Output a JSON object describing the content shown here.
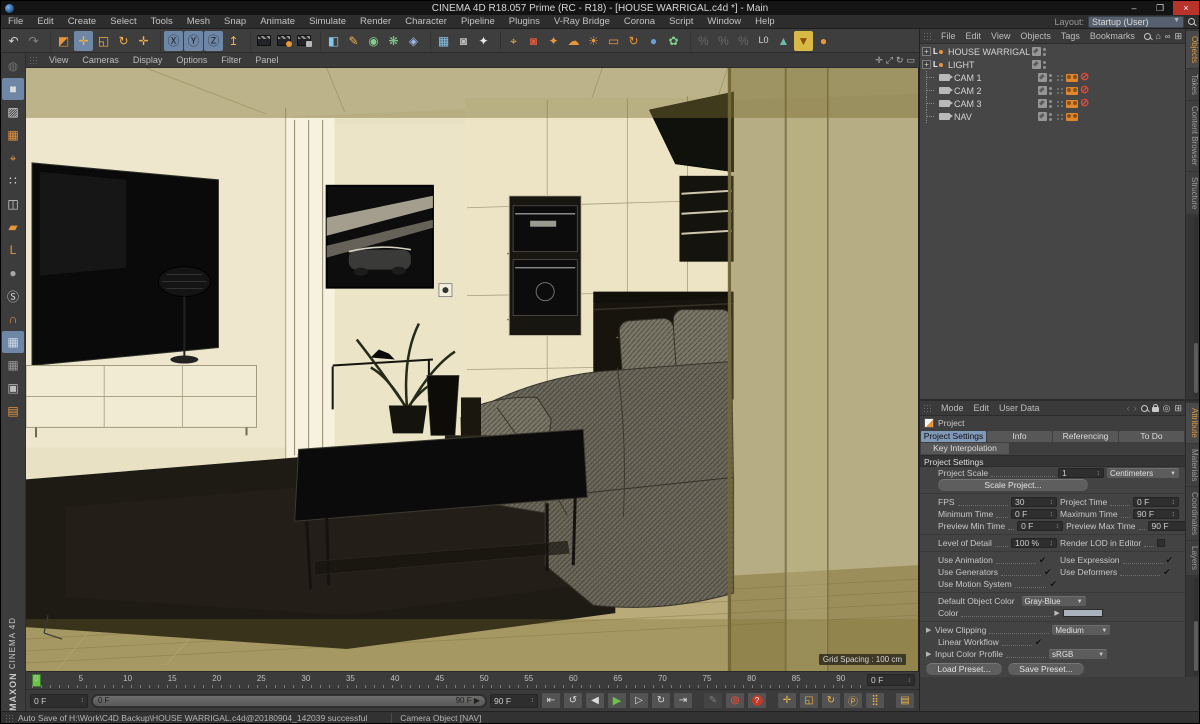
{
  "window": {
    "title": "CINEMA 4D R18.057 Prime (RC - R18) - [HOUSE WARRIGAL.c4d *] - Main",
    "minimize": "–",
    "maximize": "❐",
    "close": "×",
    "layout_label": "Layout:",
    "layout_value": "Startup (User)"
  },
  "menubar": [
    "File",
    "Edit",
    "Create",
    "Select",
    "Tools",
    "Mesh",
    "Snap",
    "Animate",
    "Simulate",
    "Render",
    "Character",
    "Pipeline",
    "Plugins",
    "V-Ray Bridge",
    "Corona",
    "Script",
    "Window",
    "Help"
  ],
  "toolbar": {
    "icons": [
      {
        "name": "undo-icon",
        "glyph": "↶",
        "color": "#d6d6d6"
      },
      {
        "name": "redo-icon",
        "glyph": "↷",
        "color": "#d6d6d6",
        "dim": true
      },
      {
        "sep": true
      },
      {
        "name": "live-selection-icon",
        "glyph": "◩",
        "color": "#e8953c"
      },
      {
        "name": "move-icon",
        "glyph": "✛",
        "color": "#f0b24a",
        "active": true
      },
      {
        "name": "scale-icon",
        "glyph": "◱",
        "color": "#f0b24a"
      },
      {
        "name": "rotate-icon",
        "glyph": "↻",
        "color": "#f0b24a"
      },
      {
        "name": "last-tool-icon",
        "glyph": "✛",
        "color": "#f0b24a"
      },
      {
        "sep": true
      },
      {
        "name": "lock-x-icon",
        "glyph": "Ⓧ",
        "color": "#1e2834",
        "active": true
      },
      {
        "name": "lock-y-icon",
        "glyph": "Ⓨ",
        "color": "#1e2834",
        "active": true
      },
      {
        "name": "lock-z-icon",
        "glyph": "Ⓩ",
        "color": "#1e2834",
        "active": true
      },
      {
        "name": "coordinate-system-icon",
        "glyph": "↥",
        "color": "#f0b24a"
      },
      {
        "sep": true
      },
      {
        "name": "render-view-icon",
        "clapper": "plain"
      },
      {
        "name": "render-to-picture-viewer-icon",
        "clapper": "oj"
      },
      {
        "name": "render-settings-icon",
        "clapper": "gr"
      },
      {
        "sep": true
      },
      {
        "name": "add-cube-icon",
        "glyph": "◧",
        "color": "#86c5ea"
      },
      {
        "name": "spline-pen-icon",
        "glyph": "✎",
        "color": "#f0b24a"
      },
      {
        "name": "subdivision-surface-icon",
        "glyph": "◉",
        "color": "#7fcf8a"
      },
      {
        "name": "array-icon",
        "glyph": "❋",
        "color": "#7fcf8a"
      },
      {
        "name": "deformer-icon",
        "glyph": "◈",
        "color": "#9fb5ec"
      },
      {
        "sep": true
      },
      {
        "name": "floor-icon",
        "glyph": "▦",
        "color": "#86c5ea"
      },
      {
        "name": "camera-icon",
        "glyph": "◙",
        "color": "#bdbdbd"
      },
      {
        "name": "light-icon",
        "glyph": "✦",
        "color": "#e8e8e8"
      },
      {
        "sep": true
      },
      {
        "name": "axis-workflow-icon",
        "glyph": "⌖",
        "color": "#f0b24a"
      },
      {
        "name": "vray-camera-icon",
        "glyph": "◙",
        "color": "#d85c3a"
      },
      {
        "name": "vray-light-icon",
        "glyph": "✦",
        "color": "#e8953c"
      },
      {
        "name": "corona-clouds-icon",
        "glyph": "☁",
        "color": "#e8953c"
      },
      {
        "name": "corona-sun-icon",
        "glyph": "☀",
        "color": "#e8953c"
      },
      {
        "name": "corona-frame-icon",
        "glyph": "▭",
        "color": "#e8953c"
      },
      {
        "name": "corona-refresh-icon",
        "glyph": "↻",
        "color": "#e8953c"
      },
      {
        "name": "corona-sphere-icon",
        "glyph": "●",
        "color": "#6a9fd8"
      },
      {
        "name": "proxy-icon",
        "glyph": "✿",
        "color": "#7fcf8a"
      },
      {
        "sep": true
      },
      {
        "name": "percent-a-icon",
        "glyph": "%",
        "color": "#9a9a9a",
        "dim": true
      },
      {
        "name": "percent-b-icon",
        "glyph": "%",
        "color": "#9a9a9a",
        "dim": true
      },
      {
        "name": "percent-c-icon",
        "glyph": "%",
        "color": "#9a9a9a",
        "dim": true
      },
      {
        "name": "l0-reset-icon",
        "glyph": "L0",
        "color": "#d6d6d6"
      },
      {
        "name": "team-render-icon",
        "glyph": "▲",
        "color": "#6fb8a8"
      },
      {
        "name": "magic-preview-icon",
        "glyph": "▼",
        "color": "#8a4f15",
        "hl": true
      },
      {
        "name": "corona-blob-icon",
        "glyph": "●",
        "color": "#e8953c"
      }
    ]
  },
  "rail": {
    "icons": [
      {
        "name": "make-editable-icon",
        "glyph": "◍",
        "color": "#bdbdbd",
        "dim": true
      },
      {
        "name": "model-mode-icon",
        "glyph": "■",
        "color": "#d8d8d8",
        "active": true
      },
      {
        "name": "texture-mode-icon",
        "glyph": "▨",
        "color": "#d8d8d8"
      },
      {
        "name": "workplane-mode-icon",
        "glyph": "▦",
        "color": "#e8953c"
      },
      {
        "name": "object-axis-mode-icon",
        "glyph": "⌖",
        "color": "#e8953c"
      },
      {
        "name": "points-mode-icon",
        "glyph": "∷",
        "color": "#d8d8d8"
      },
      {
        "name": "edges-mode-icon",
        "glyph": "◫",
        "color": "#d8d8d8"
      },
      {
        "name": "polygons-mode-icon",
        "glyph": "▰",
        "color": "#e8953c"
      },
      {
        "name": "axis-lock-icon",
        "glyph": "L",
        "color": "#e8953c"
      },
      {
        "name": "mouse-icon",
        "glyph": "●",
        "color": "#a8a8a8"
      },
      {
        "name": "snap-toggle-icon",
        "glyph": "Ⓢ",
        "color": "#d8d8d8"
      },
      {
        "name": "magnet-snap-icon",
        "glyph": "∩",
        "color": "#e8953c"
      },
      {
        "name": "workplane-lock-icon",
        "glyph": "▦",
        "color": "#cfd8e6",
        "active": true
      },
      {
        "name": "planar-workplane-icon",
        "glyph": "▦",
        "color": "#9a9a9a"
      },
      {
        "name": "solo-box-icon",
        "glyph": "▣",
        "color": "#bdbdbd"
      },
      {
        "name": "export-file-icon",
        "glyph": "▤",
        "color": "#e8953c"
      }
    ]
  },
  "viewport": {
    "menu": [
      "View",
      "Cameras",
      "Display",
      "Options",
      "Filter",
      "Panel"
    ],
    "nav_icons": [
      {
        "name": "viewport-move-icon",
        "glyph": "✛"
      },
      {
        "name": "viewport-zoom-icon",
        "glyph": "⤢"
      },
      {
        "name": "viewport-rotate-icon",
        "glyph": "↻"
      },
      {
        "name": "viewport-maximize-icon",
        "glyph": "▭"
      }
    ],
    "grid_spacing": "Grid Spacing : 100 cm"
  },
  "object_manager": {
    "menu": [
      "File",
      "Edit",
      "View",
      "Objects",
      "Tags",
      "Bookmarks"
    ],
    "objects": [
      {
        "name": "HOUSE WARRIGAL",
        "icon": "xref",
        "expandable": true,
        "tags": []
      },
      {
        "name": "LIGHT",
        "icon": "xref",
        "expandable": true,
        "tags": []
      },
      {
        "name": "CAM 1",
        "icon": "camera",
        "tags": [
          "marker",
          "vray-camera",
          "no-sign"
        ]
      },
      {
        "name": "CAM 2",
        "icon": "camera",
        "tags": [
          "marker",
          "vray-camera",
          "no-sign"
        ]
      },
      {
        "name": "CAM 3",
        "icon": "camera",
        "tags": [
          "marker",
          "vray-camera",
          "no-sign"
        ]
      },
      {
        "name": "NAV",
        "icon": "camera",
        "tags": [
          "marker",
          "vray-camera"
        ]
      }
    ],
    "side_tabs": [
      "Objects",
      "Takes",
      "Content Browser",
      "Structure"
    ],
    "active_side_tab": "Objects"
  },
  "attribute_manager": {
    "menu": [
      "Mode",
      "Edit",
      "User Data"
    ],
    "object_label": "Project",
    "tabs": [
      "Project Settings",
      "Info",
      "Referencing",
      "To Do",
      "Key Interpolation"
    ],
    "active_tab": "Project Settings",
    "section": "Project Settings",
    "project_scale": {
      "label": "Project Scale",
      "value": "1",
      "unit": "Centimeters"
    },
    "scale_button": "Scale Project...",
    "time_fields": [
      {
        "label": "FPS",
        "value": "30"
      },
      {
        "label": "Project Time",
        "value": "0 F"
      },
      {
        "label": "Minimum Time",
        "value": "0 F"
      },
      {
        "label": "Maximum Time",
        "value": "90 F"
      },
      {
        "label": "Preview Min Time",
        "value": "0 F"
      },
      {
        "label": "Preview Max Time",
        "value": "90 F"
      }
    ],
    "lod": {
      "label": "Level of Detail",
      "value": "100 %"
    },
    "render_lod": {
      "label": "Render LOD in Editor",
      "checked": false
    },
    "toggles": [
      {
        "label": "Use Animation",
        "checked": true
      },
      {
        "label": "Use Expression",
        "checked": true
      },
      {
        "label": "Use Generators",
        "checked": true
      },
      {
        "label": "Use Deformers",
        "checked": true
      },
      {
        "label": "Use Motion System",
        "checked": true
      }
    ],
    "default_object_color": {
      "label": "Default Object Color",
      "value": "Gray-Blue"
    },
    "color_row": {
      "label": "Color"
    },
    "view_clipping": {
      "label": "View Clipping",
      "value": "Medium"
    },
    "linear_workflow": {
      "label": "Linear Workflow",
      "checked": true
    },
    "input_color_profile": {
      "label": "Input Color Profile",
      "value": "sRGB"
    },
    "preset_buttons": [
      "Load Preset...",
      "Save Preset..."
    ],
    "side_tabs": [
      "Attribute",
      "Materials",
      "Coordinates",
      "Layers"
    ],
    "active_side_tab": "Attribute"
  },
  "timeline": {
    "tick_labels": [
      "0",
      "5",
      "10",
      "15",
      "20",
      "25",
      "30",
      "35",
      "40",
      "45",
      "50",
      "55",
      "60",
      "65",
      "70",
      "75",
      "80",
      "85",
      "90"
    ],
    "max_frame": 93,
    "current_frame": "0 F"
  },
  "transport": {
    "start_field": "0 F",
    "slider_start": "0 F",
    "slider_end": "90 F ▶",
    "end_field": "90 F",
    "buttons": [
      {
        "name": "goto-start-button",
        "glyph": "⇤"
      },
      {
        "name": "play-backwards-button",
        "glyph": "↺"
      },
      {
        "name": "previous-frame-button",
        "glyph": "◀"
      },
      {
        "name": "play-forwards-button",
        "glyph": "▶",
        "cls": "play"
      },
      {
        "name": "next-frame-button",
        "glyph": "▷"
      },
      {
        "name": "play-loop-button",
        "glyph": "↻"
      },
      {
        "name": "goto-end-button",
        "glyph": "⇥"
      }
    ],
    "record_buttons": [
      {
        "name": "record-active-objects-button",
        "glyph": "✎",
        "cls": "dim"
      },
      {
        "name": "autokeying-button",
        "glyph": "◎",
        "cls": "red"
      },
      {
        "name": "keyframe-help-button",
        "glyph": "?",
        "cls": "qm"
      }
    ],
    "key_toggles": [
      {
        "name": "key-position-button",
        "glyph": "✛"
      },
      {
        "name": "key-scale-button",
        "glyph": "◱"
      },
      {
        "name": "key-rotation-button",
        "glyph": "↻"
      },
      {
        "name": "key-parameter-button",
        "glyph": "Ⓟ"
      },
      {
        "name": "key-pla-button",
        "glyph": "⣿"
      }
    ],
    "film_button": {
      "name": "keyframe-selection-button",
      "glyph": "▤"
    }
  },
  "statusbar": {
    "message": "Auto Save of H:\\Work\\C4D Backup\\HOUSE WARRIGAL.c4d@20180904_142039 successful",
    "context": "Camera Object [NAV]"
  },
  "brand": {
    "maxon": "MAXON",
    "cinema": "CINEMA 4D"
  }
}
